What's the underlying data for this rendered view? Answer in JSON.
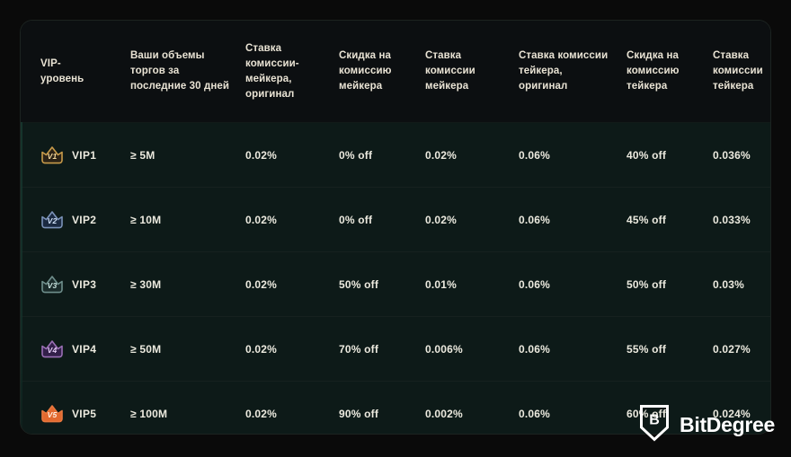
{
  "table": {
    "headers": [
      "VIP-\nуровень",
      "Ваши объемы\nторгов за\nпоследние 30 дней",
      "Ставка комиссии-\nмейкера,\nоригинал",
      "Скидка на\nкомиссию\nмейкера",
      "Ставка\nкомиссии\nмейкера",
      "Ставка комиссии\nтейкера,\nоригинал",
      "Скидка на\nкомиссию\nтейкера",
      "Ставка\nкомиссии\nтейкера"
    ],
    "rows": [
      {
        "badge_text": "V1",
        "badge_color": "#c89b4a",
        "badge_fill": "#2b2216",
        "badge_text_color": "#f2d79b",
        "level": "VIP1",
        "volume": "≥ 5M",
        "maker_original": "0.02%",
        "maker_discount": "0% off",
        "maker_rate": "0.02%",
        "taker_original": "0.06%",
        "taker_discount": "40% off",
        "taker_rate": "0.036%"
      },
      {
        "badge_text": "V2",
        "badge_color": "#7b92b8",
        "badge_fill": "#1b2a41",
        "badge_text_color": "#cfe0f5",
        "level": "VIP2",
        "volume": "≥ 10M",
        "maker_original": "0.02%",
        "maker_discount": "0% off",
        "maker_rate": "0.02%",
        "taker_original": "0.06%",
        "taker_discount": "45% off",
        "taker_rate": "0.033%"
      },
      {
        "badge_text": "V3",
        "badge_color": "#6f8f8c",
        "badge_fill": "#1a2b2a",
        "badge_text_color": "#cbe6e2",
        "level": "VIP3",
        "volume": "≥ 30M",
        "maker_original": "0.02%",
        "maker_discount": "50% off",
        "maker_rate": "0.01%",
        "taker_original": "0.06%",
        "taker_discount": "50% off",
        "taker_rate": "0.03%"
      },
      {
        "badge_text": "V4",
        "badge_color": "#9a6fb5",
        "badge_fill": "#33204a",
        "badge_text_color": "#e4cdf5",
        "level": "VIP4",
        "volume": "≥ 50M",
        "maker_original": "0.02%",
        "maker_discount": "70% off",
        "maker_rate": "0.006%",
        "taker_original": "0.06%",
        "taker_discount": "55% off",
        "taker_rate": "0.027%"
      },
      {
        "badge_text": "V5",
        "badge_color": "#e8773e",
        "badge_fill": "#e2692f",
        "badge_text_color": "#fff0e2",
        "level": "VIP5",
        "volume": "≥ 100M",
        "maker_original": "0.02%",
        "maker_discount": "90% off",
        "maker_rate": "0.002%",
        "taker_original": "0.06%",
        "taker_discount": "60% off",
        "taker_rate": "0.024%"
      }
    ]
  },
  "watermark": {
    "brand": "BitDegree",
    "logo_letter": "B"
  },
  "colors": {
    "page_background": "#0a0a0a",
    "header_background": "#0c0f11",
    "row_background": "#0d1a18",
    "header_text": "#e9e3d4",
    "cell_text": "#eceadf",
    "divider": "#16211f"
  }
}
